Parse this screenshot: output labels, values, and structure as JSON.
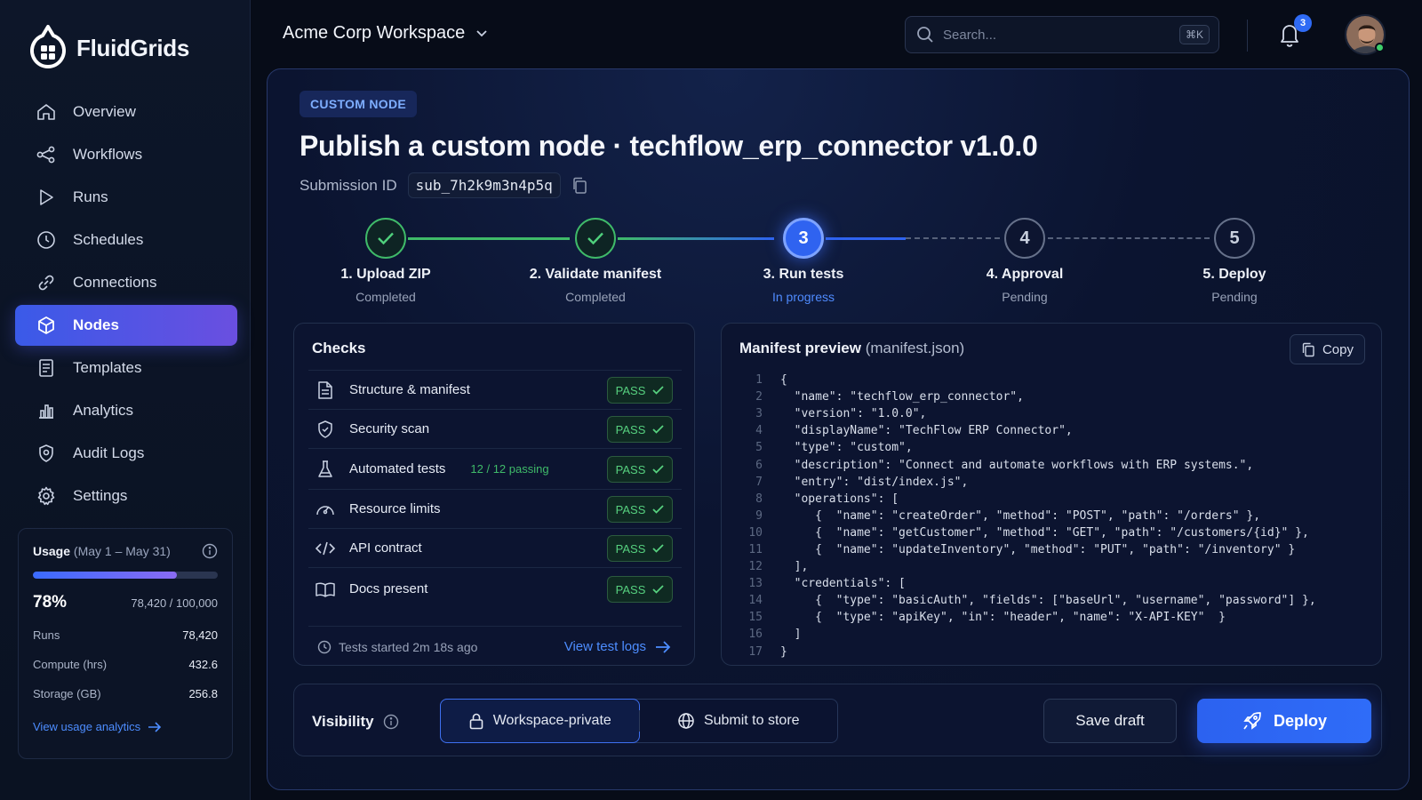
{
  "brand": {
    "name": "FluidGrids"
  },
  "sidebar": {
    "items": [
      {
        "label": "Overview",
        "icon": "home-icon"
      },
      {
        "label": "Workflows",
        "icon": "workflow-icon"
      },
      {
        "label": "Runs",
        "icon": "play-icon"
      },
      {
        "label": "Schedules",
        "icon": "clock-icon"
      },
      {
        "label": "Connections",
        "icon": "link-icon"
      },
      {
        "label": "Nodes",
        "icon": "cube-icon",
        "active": true
      },
      {
        "label": "Templates",
        "icon": "document-icon"
      },
      {
        "label": "Analytics",
        "icon": "bar-chart-icon"
      },
      {
        "label": "Audit Logs",
        "icon": "shield-icon"
      },
      {
        "label": "Settings",
        "icon": "gear-icon"
      }
    ]
  },
  "usage": {
    "title": "Usage",
    "period": "(May 1 – May 31)",
    "percent_label": "78%",
    "percent_value": 0.78,
    "count": "78,420 / 100,000",
    "stats": [
      {
        "label": "Runs",
        "value": "78,420"
      },
      {
        "label": "Compute (hrs)",
        "value": "432.6"
      },
      {
        "label": "Storage (GB)",
        "value": "256.8"
      }
    ],
    "link": "View usage analytics"
  },
  "topbar": {
    "workspace": "Acme Corp Workspace",
    "search_placeholder": "Search...",
    "search_shortcut": "⌘K",
    "notification_count": "3"
  },
  "page": {
    "tag": "CUSTOM NODE",
    "title": "Publish a custom node · techflow_erp_connector v1.0.0",
    "submission_label": "Submission ID",
    "submission_id": "sub_7h2k9m3n4p5q"
  },
  "steps": [
    {
      "label": "1. Upload ZIP",
      "status": "Completed",
      "state": "done"
    },
    {
      "label": "2. Validate manifest",
      "status": "Completed",
      "state": "done"
    },
    {
      "label": "3. Run tests",
      "status": "In progress",
      "state": "current",
      "number": "3"
    },
    {
      "label": "4. Approval",
      "status": "Pending",
      "state": "pending",
      "number": "4"
    },
    {
      "label": "5. Deploy",
      "status": "Pending",
      "state": "pending",
      "number": "5"
    }
  ],
  "checks": {
    "title": "Checks",
    "items": [
      {
        "label": "Structure & manifest",
        "result": "PASS",
        "icon": "file-icon"
      },
      {
        "label": "Security scan",
        "result": "PASS",
        "icon": "shield-check-icon"
      },
      {
        "label": "Automated tests",
        "extra": "12 / 12 passing",
        "result": "PASS",
        "icon": "flask-icon"
      },
      {
        "label": "Resource limits",
        "result": "PASS",
        "icon": "gauge-icon"
      },
      {
        "label": "API contract",
        "result": "PASS",
        "icon": "code-icon"
      },
      {
        "label": "Docs present",
        "result": "PASS",
        "icon": "book-icon"
      }
    ],
    "footer": "Tests started 2m 18s ago",
    "link": "View test logs"
  },
  "manifest": {
    "title": "Manifest preview",
    "filename": "(manifest.json)",
    "copy_label": "Copy",
    "lines": [
      "{",
      "  \"name\": \"techflow_erp_connector\",",
      "  \"version\": \"1.0.0\",",
      "  \"displayName\": \"TechFlow ERP Connector\",",
      "  \"type\": \"custom\",",
      "  \"description\": \"Connect and automate workflows with ERP systems.\",",
      "  \"entry\": \"dist/index.js\",",
      "  \"operations\": [",
      "     {  \"name\": \"createOrder\", \"method\": \"POST\", \"path\": \"/orders\" },",
      "     {  \"name\": \"getCustomer\", \"method\": \"GET\", \"path\": \"/customers/{id}\" },",
      "     {  \"name\": \"updateInventory\", \"method\": \"PUT\", \"path\": \"/inventory\" }",
      "  ],",
      "  \"credentials\": [",
      "     {  \"type\": \"basicAuth\", \"fields\": [\"baseUrl\", \"username\", \"password\"] },",
      "     {  \"type\": \"apiKey\", \"in\": \"header\", \"name\": \"X-API-KEY\"  }",
      "  ]",
      "}"
    ]
  },
  "bottom": {
    "visibility_label": "Visibility",
    "option_private": "Workspace-private",
    "option_store": "Submit to store",
    "save_draft": "Save draft",
    "deploy": "Deploy"
  },
  "colors": {
    "accent": "#2f63f0",
    "success": "#3fba69",
    "link": "#4d8dff",
    "background": "#070c18"
  }
}
